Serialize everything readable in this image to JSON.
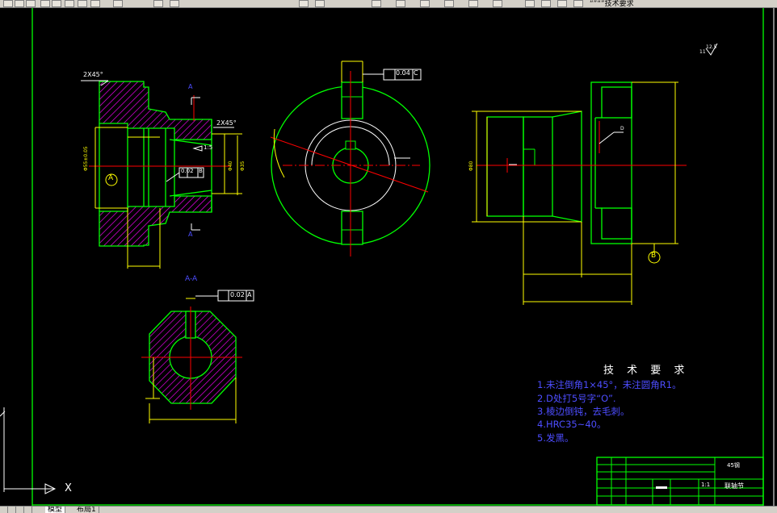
{
  "toolbar": {
    "label": "“”“”技术要求"
  },
  "tabs": {
    "model": "模型",
    "layout1": "布局1"
  },
  "ucs": {
    "x_label": "X"
  },
  "drawing": {
    "chamfer_top": "2X45°",
    "chamfer_mid": "2X45°",
    "section_mark_a_top": "A",
    "section_mark_a_bottom": "A",
    "datum_a": "A",
    "datum_b": "B",
    "taper": "1:5",
    "tol_runout_val": "0.02",
    "tol_runout_ref": "B",
    "tol_sym_val": "0.04",
    "tol_sym_ref": "C",
    "tol_aa_val": "0.02",
    "tol_aa_ref": "A",
    "section_title": "A-A",
    "surface_roughness": "12.5",
    "roughness_prefix": "11",
    "d_label": "D",
    "dim_left_dia": "Φ55±0.05",
    "dim_bore": "Φ40",
    "dim_right_dia": "Φ35",
    "dim_side_len": "Φ80"
  },
  "tech_requirements": {
    "title": "技 术 要 求",
    "lines": [
      "1.未注倒角1×45°，未注圆角R1。",
      "2.D处打5号字“O”.",
      "3.棱边倒钝，去毛刺。",
      "4.HRC35~40。",
      "5.发黑。"
    ]
  },
  "title_block": {
    "material": "45钢",
    "part_name": "联轴节",
    "scale": "1:1"
  },
  "colors": {
    "background": "#000000",
    "geometry": "#00ff00",
    "dimension": "#ffff00",
    "hatch": "#ff00ff",
    "centerline": "#ff0000",
    "text": "#ffffff",
    "tech_text": "#4d4dff"
  }
}
